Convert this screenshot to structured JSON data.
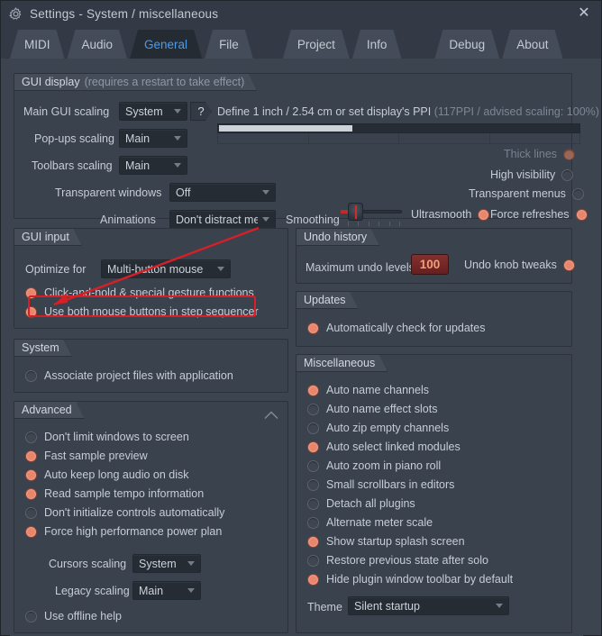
{
  "window": {
    "title": "Settings - System / miscellaneous",
    "gear_icon": "gear-icon",
    "close_label": "✕"
  },
  "tabs": [
    {
      "label": "MIDI",
      "active": false
    },
    {
      "label": "Audio",
      "active": false
    },
    {
      "label": "General",
      "active": true
    },
    {
      "label": "File",
      "active": false
    },
    {
      "label": "Project",
      "active": false
    },
    {
      "label": "Info",
      "active": false
    },
    {
      "label": "Debug",
      "active": false
    },
    {
      "label": "About",
      "active": false
    }
  ],
  "gui_display": {
    "legend": "GUI display",
    "legend_note": "(requires a restart to take effect)",
    "main_gui_scaling_label": "Main GUI scaling",
    "main_gui_scaling_value": "System",
    "help_label": "?",
    "ppi_text": "Define 1 inch / 2.54 cm or set display's PPI",
    "ppi_note": "(117PPI / advised scaling: 100%)",
    "ppi_fill_percent": 37,
    "popups_scaling_label": "Pop-ups scaling",
    "popups_scaling_value": "Main",
    "toolbars_scaling_label": "Toolbars scaling",
    "toolbars_scaling_value": "Main",
    "transparent_windows_label": "Transparent windows",
    "transparent_windows_value": "Off",
    "animations_label": "Animations",
    "animations_value": "Don't distract me",
    "smoothing_label": "Smoothing",
    "thick_lines": {
      "label": "Thick lines",
      "state": "on",
      "disabled": true
    },
    "high_visibility": {
      "label": "High visibility",
      "state": "off",
      "disabled": false
    },
    "transparent_menus": {
      "label": "Transparent menus",
      "state": "off",
      "disabled": false
    },
    "ultrasmooth": {
      "label": "Ultrasmooth",
      "state": "on",
      "disabled": false
    },
    "force_refreshes": {
      "label": "Force refreshes",
      "state": "on",
      "disabled": false
    }
  },
  "gui_input": {
    "legend": "GUI input",
    "optimize_label": "Optimize for",
    "optimize_value": "Multi-button mouse",
    "options": [
      {
        "label": "Click-and-hold & special gesture functions",
        "state": "on"
      },
      {
        "label": "Use both mouse buttons in step sequencer",
        "state": "on"
      }
    ]
  },
  "system": {
    "legend": "System",
    "options": [
      {
        "label": "Associate project files with application",
        "state": "off"
      }
    ]
  },
  "advanced": {
    "legend": "Advanced",
    "collapse_icon": "chevron-up-icon",
    "options": [
      {
        "label": "Don't limit windows to screen",
        "state": "off"
      },
      {
        "label": "Fast sample preview",
        "state": "on"
      },
      {
        "label": "Auto keep long audio on disk",
        "state": "on"
      },
      {
        "label": "Read sample tempo information",
        "state": "on"
      },
      {
        "label": "Don't initialize controls automatically",
        "state": "off"
      },
      {
        "label": "Force high performance power plan",
        "state": "on"
      }
    ],
    "cursors_scaling_label": "Cursors scaling",
    "cursors_scaling_value": "System",
    "legacy_scaling_label": "Legacy scaling",
    "legacy_scaling_value": "Main",
    "offline_help": {
      "label": "Use offline help",
      "state": "off"
    }
  },
  "undo_history": {
    "legend": "Undo history",
    "max_levels_label": "Maximum undo levels",
    "max_levels_value": "100",
    "undo_knob_tweaks": {
      "label": "Undo knob tweaks",
      "state": "on"
    }
  },
  "updates": {
    "legend": "Updates",
    "options": [
      {
        "label": "Automatically check for updates",
        "state": "on"
      }
    ]
  },
  "miscellaneous": {
    "legend": "Miscellaneous",
    "options": [
      {
        "label": "Auto name channels",
        "state": "on"
      },
      {
        "label": "Auto name effect slots",
        "state": "off"
      },
      {
        "label": "Auto zip empty channels",
        "state": "off"
      },
      {
        "label": "Auto select linked modules",
        "state": "on"
      },
      {
        "label": "Auto zoom in piano roll",
        "state": "off"
      },
      {
        "label": "Small scrollbars in editors",
        "state": "off"
      },
      {
        "label": "Detach all plugins",
        "state": "off"
      },
      {
        "label": "Alternate meter scale",
        "state": "off"
      },
      {
        "label": "Show startup splash screen",
        "state": "on"
      },
      {
        "label": "Restore previous state after solo",
        "state": "off"
      },
      {
        "label": "Hide plugin window toolbar by default",
        "state": "on"
      }
    ],
    "theme_label": "Theme",
    "theme_value": "Silent startup"
  },
  "annotation": {
    "color": "#d81f26",
    "target": "Click-and-hold & special gesture functions"
  },
  "colors": {
    "accent_on": "#e8866c",
    "tab_active_text": "#4b9ced",
    "panel_bg": "#3a424d",
    "window_bg": "#3c4450",
    "titlebar_bg": "#333a45",
    "numeric_field_bg": "#83302f",
    "numeric_field_text": "#f0a07a"
  }
}
